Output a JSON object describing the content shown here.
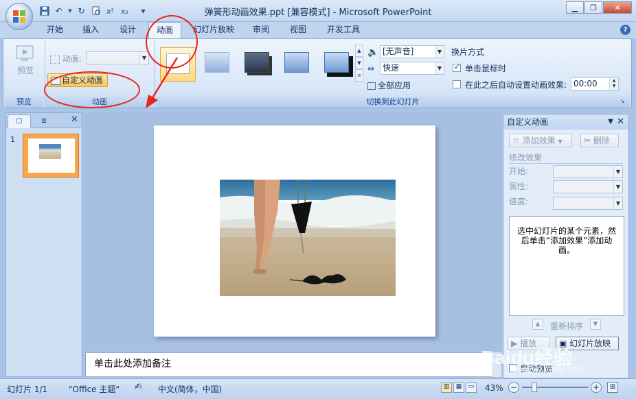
{
  "window": {
    "title": "弹簧形动画效果.ppt [兼容模式] - Microsoft PowerPoint",
    "minimize": "▁",
    "restore": "❐",
    "close": "✕"
  },
  "ribbon_tabs": [
    "开始",
    "插入",
    "设计",
    "动画",
    "幻灯片放映",
    "审阅",
    "视图",
    "开发工具"
  ],
  "active_tab": "动画",
  "help": "?",
  "groups": {
    "preview": {
      "button": "预览",
      "label": "预览"
    },
    "animation": {
      "anim_label": "动画:",
      "custom_button": "自定义动画",
      "label": "动画"
    },
    "transition": {
      "sound_value": "[无声音]",
      "speed_value": "快速",
      "apply_all": "全部应用",
      "label": "切换到此幻灯片",
      "advance_heading": "换片方式",
      "on_click": "单击鼠标时",
      "on_click_checked": true,
      "auto_after": "在此之后自动设置动画效果:",
      "auto_after_checked": false,
      "auto_time": "00:00"
    }
  },
  "slides_panel": {
    "slide_number": "1"
  },
  "notes_placeholder": "单击此处添加备注",
  "task_pane": {
    "title": "自定义动画",
    "add_effect": "添加效果",
    "remove": "删除",
    "modify_heading": "修改效果",
    "start_label": "开始:",
    "property_label": "属性:",
    "speed_label": "速度:",
    "hint": "选中幻灯片的某个元素，然后单击“添加效果”添加动画。",
    "reorder": "重新排序",
    "play": "播放",
    "slideshow": "幻灯片放映",
    "autopreview": "自动预览",
    "autopreview_checked": false
  },
  "status_bar": {
    "slide": "幻灯片 1/1",
    "theme": "\"Office 主题\"",
    "language": "中文(简体，中国)",
    "zoom": "43%"
  },
  "watermark": {
    "text": "Baidu经验",
    "url": "jingyan.baidu.com"
  },
  "colors": {
    "annotation_red": "#e8241a",
    "thumb_highlight": "#f9a64a"
  }
}
